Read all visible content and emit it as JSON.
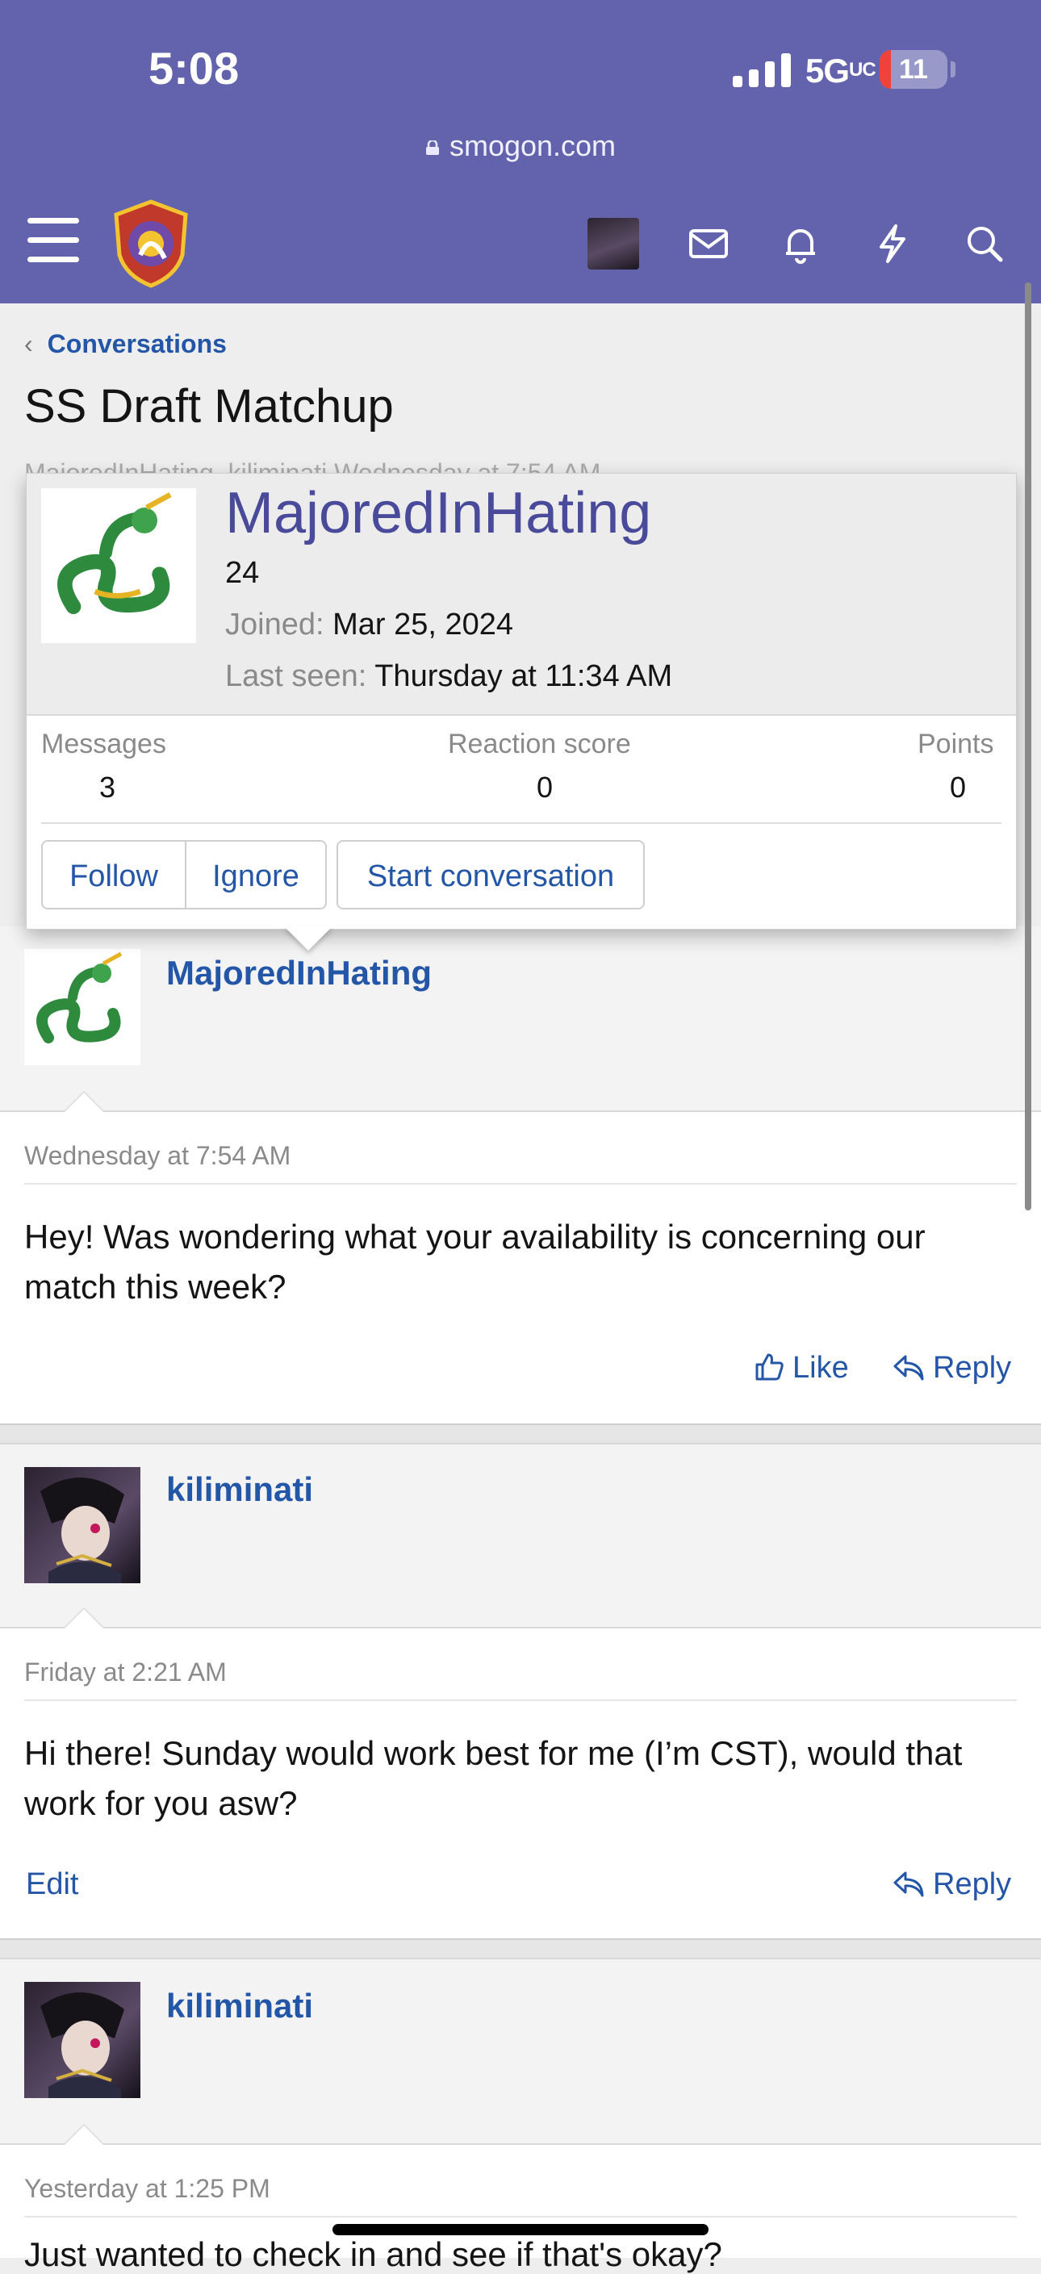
{
  "status_bar": {
    "time": "5:08",
    "network": "5G",
    "network_suffix": "UC",
    "battery": "11"
  },
  "browser": {
    "url": "smogon.com"
  },
  "header": {
    "icons": [
      "menu-icon",
      "site-logo",
      "user-avatar",
      "mail-icon",
      "bell-icon",
      "bolt-icon",
      "search-icon"
    ]
  },
  "breadcrumb": {
    "label": "Conversations"
  },
  "page": {
    "title": "SS Draft Matchup",
    "meta_obscured": "MajoredInHating, kiliminati   Wednesday at 7:54 AM"
  },
  "member_tooltip": {
    "username": "MajoredInHating",
    "title_line": "24",
    "joined_label": "Joined:",
    "joined_value": "Mar 25, 2024",
    "last_seen_label": "Last seen:",
    "last_seen_value": "Thursday at 11:34 AM",
    "stats": [
      {
        "label": "Messages",
        "value": "3"
      },
      {
        "label": "Reaction score",
        "value": "0"
      },
      {
        "label": "Points",
        "value": "0"
      }
    ],
    "buttons": {
      "follow": "Follow",
      "ignore": "Ignore",
      "start": "Start conversation"
    }
  },
  "messages": [
    {
      "author": "MajoredInHating",
      "date": "Wednesday at 7:54 AM",
      "text": "Hey! Was wondering what your availability is concerning our match this week?",
      "actions": {
        "like": "Like",
        "reply": "Reply"
      }
    },
    {
      "author": "kiliminati",
      "date": "Friday at 2:21 AM",
      "text": "Hi there! Sunday would work best for me (I’m CST), would that work for you asw?",
      "actions": {
        "edit": "Edit",
        "reply": "Reply"
      }
    },
    {
      "author": "kiliminati",
      "date": "Yesterday at 1:25 PM",
      "text": "Just wanted to check in and see if that's okay?"
    }
  ],
  "colors": {
    "header": "#6363ad",
    "link": "#2456a8",
    "username_tooltip": "#4a4a9a"
  }
}
